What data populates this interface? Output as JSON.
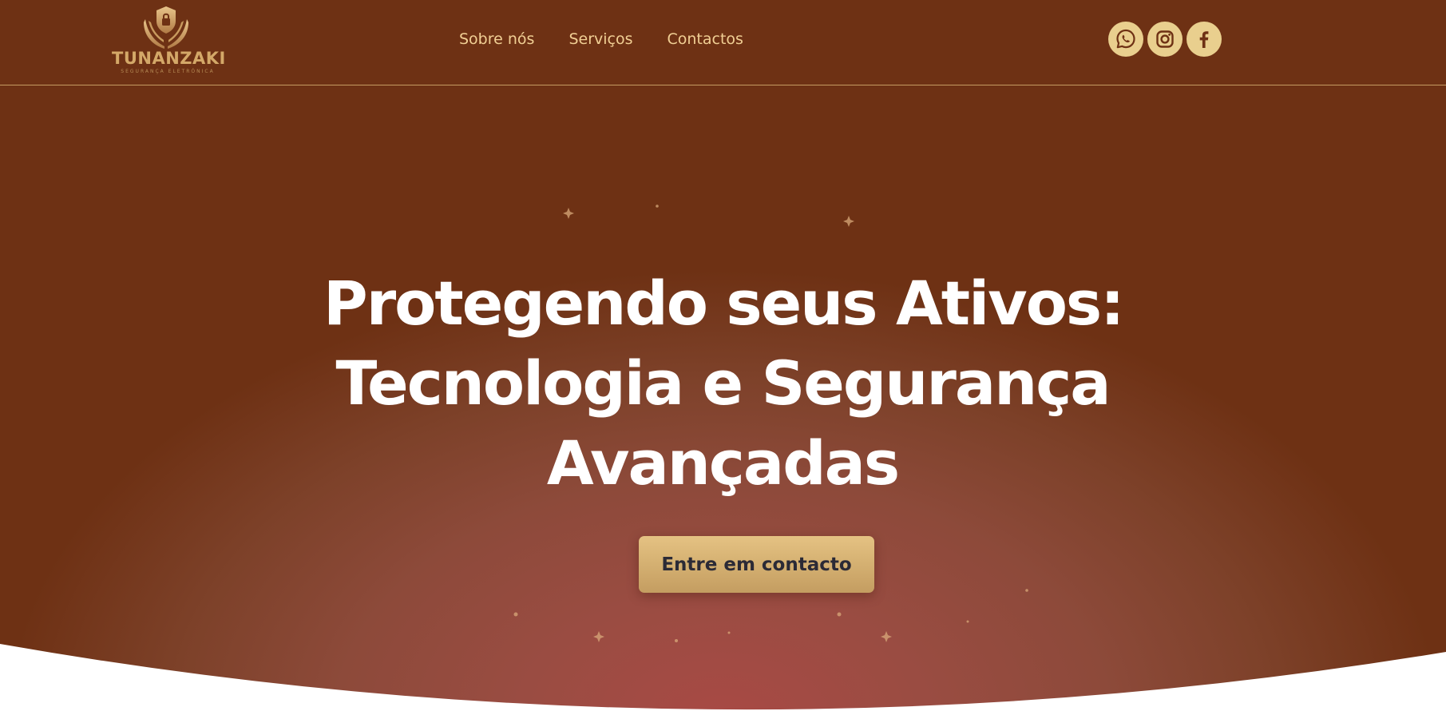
{
  "brand": {
    "name": "TUNANZAKI",
    "tagline": "SEGURANÇA ELETRÓNICA",
    "logo_icon": "shield-lock-hands-icon"
  },
  "nav": {
    "items": [
      {
        "label": "Sobre nós"
      },
      {
        "label": "Serviços"
      },
      {
        "label": "Contactos"
      }
    ]
  },
  "socials": [
    {
      "name": "whatsapp",
      "icon": "whatsapp-icon"
    },
    {
      "name": "instagram",
      "icon": "instagram-icon"
    },
    {
      "name": "facebook",
      "icon": "facebook-icon"
    }
  ],
  "hero": {
    "headline_lines": [
      "Protegendo seus Ativos:",
      "Tecnologia e Segurança",
      "Avançadas"
    ],
    "cta_label": "Entre em contacto"
  },
  "colors": {
    "header_bg": "#6e3114",
    "hero_glow": "#a84a45",
    "gold": "#d6b273",
    "nav_text": "#f1cf94",
    "headline": "#ffffff",
    "cta_text": "#2b2a36"
  }
}
